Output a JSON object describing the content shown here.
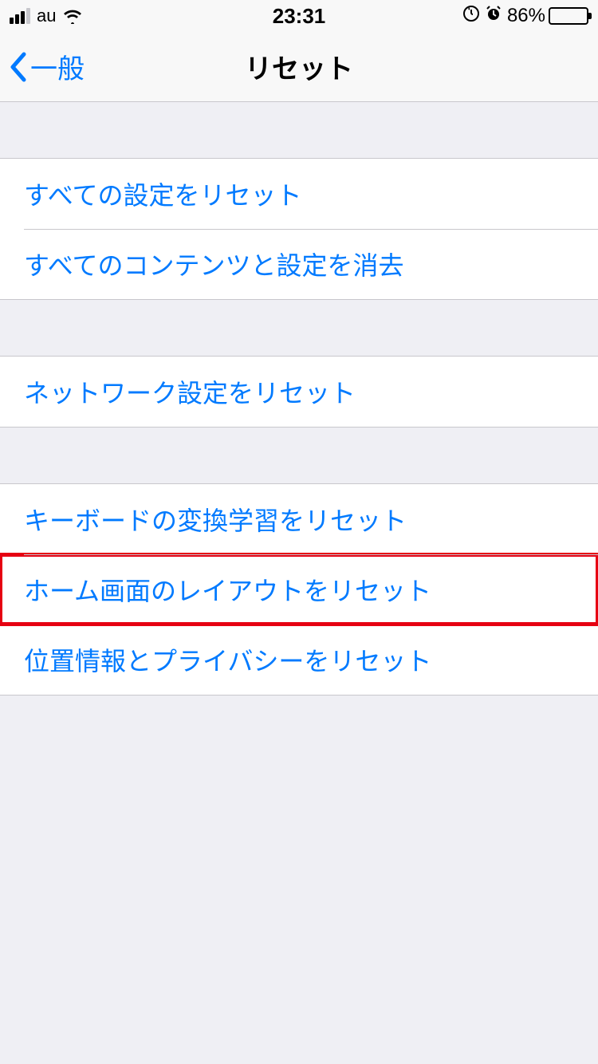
{
  "status": {
    "carrier": "au",
    "time": "23:31",
    "battery_pct": "86%"
  },
  "nav": {
    "back_label": "一般",
    "title": "リセット"
  },
  "groups": [
    {
      "rows": [
        {
          "label": "すべての設定をリセット",
          "name": "reset-all-settings",
          "highlight": false
        },
        {
          "label": "すべてのコンテンツと設定を消去",
          "name": "erase-all-content",
          "highlight": false
        }
      ]
    },
    {
      "rows": [
        {
          "label": "ネットワーク設定をリセット",
          "name": "reset-network-settings",
          "highlight": false
        }
      ]
    },
    {
      "rows": [
        {
          "label": "キーボードの変換学習をリセット",
          "name": "reset-keyboard-dictionary",
          "highlight": false
        },
        {
          "label": "ホーム画面のレイアウトをリセット",
          "name": "reset-home-layout",
          "highlight": true
        },
        {
          "label": "位置情報とプライバシーをリセット",
          "name": "reset-location-privacy",
          "highlight": false
        }
      ]
    }
  ]
}
